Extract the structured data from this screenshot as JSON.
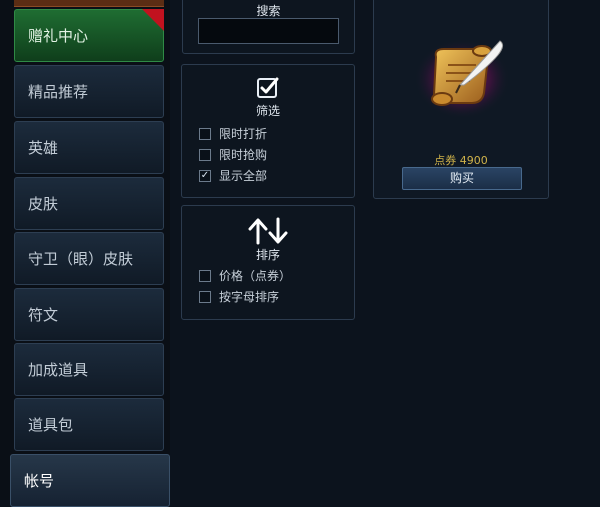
{
  "sidebar": {
    "items": [
      {
        "label": "赠礼中心"
      },
      {
        "label": "精品推荐"
      },
      {
        "label": "英雄"
      },
      {
        "label": "皮肤"
      },
      {
        "label": "守卫（眼）皮肤"
      },
      {
        "label": "符文"
      },
      {
        "label": "加成道具"
      },
      {
        "label": "道具包"
      },
      {
        "label": "帐号"
      }
    ]
  },
  "search": {
    "title": "搜索",
    "value": ""
  },
  "filter": {
    "title": "筛选",
    "options": [
      {
        "label": "限时打折",
        "checked": false
      },
      {
        "label": "限时抢购",
        "checked": false
      },
      {
        "label": "显示全部",
        "checked": true
      }
    ]
  },
  "sort": {
    "title": "排序",
    "options": [
      {
        "label": "价格（点券）",
        "checked": false
      },
      {
        "label": "按字母排序",
        "checked": false
      }
    ]
  },
  "product": {
    "price_label": "点券 4900",
    "buy_label": "购买"
  },
  "colors": {
    "gift_green": "#1f6d32",
    "price_gold": "#cfb24a",
    "ribbon_red": "#c1121f"
  }
}
